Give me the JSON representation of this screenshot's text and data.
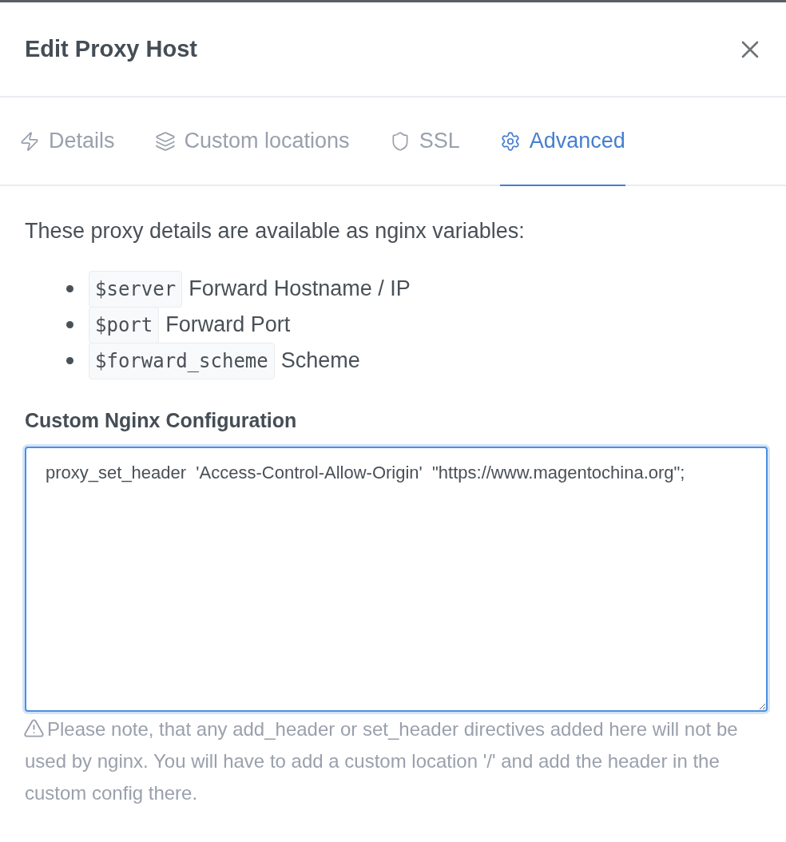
{
  "dialog": {
    "title": "Edit Proxy Host"
  },
  "tabs": [
    {
      "label": "Details",
      "selected": false
    },
    {
      "label": "Custom locations",
      "selected": false
    },
    {
      "label": "SSL",
      "selected": false
    },
    {
      "label": "Advanced",
      "selected": true
    }
  ],
  "intro": "These proxy details are available as nginx variables:",
  "variables": [
    {
      "code": "$server",
      "description": "Forward Hostname / IP"
    },
    {
      "code": "$port",
      "description": "Forward Port"
    },
    {
      "code": "$forward_scheme",
      "description": "Scheme"
    }
  ],
  "config": {
    "label": "Custom Nginx Configuration",
    "value": "proxy_set_header  'Access-Control-Allow-Origin'  \"https://www.magentochina.org\";",
    "focused": true
  },
  "note": "Please note, that any add_header or set_header directives added here will not be used by nginx. You will have to add a custom location '/' and add the header in the custom config there."
}
